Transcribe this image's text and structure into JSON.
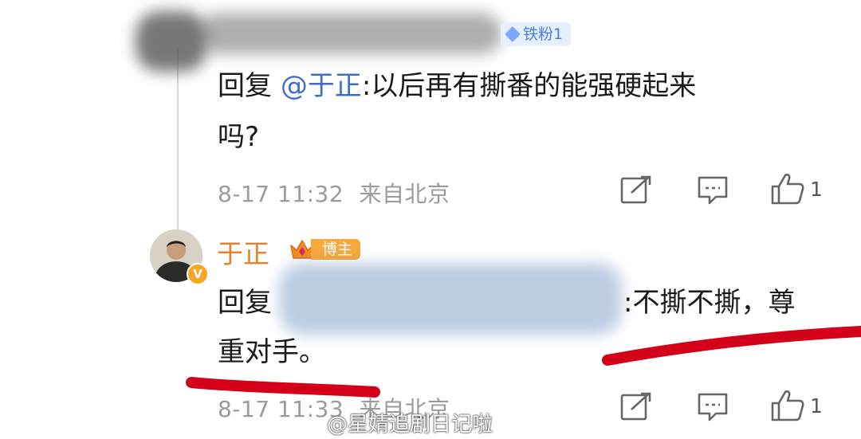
{
  "reply1": {
    "fan_badge": "铁粉1",
    "prefix": "回复",
    "mention": "@于正",
    "text_line1": ":以后再有撕番的能强硬起来",
    "text_line2": "吗?",
    "time": "8-17 11:32",
    "location": "来自北京",
    "like_count": "1"
  },
  "reply2": {
    "author": "于正",
    "badge": "博主",
    "prefix": "回复",
    "text_line1_tail": ":不撕不撕，尊",
    "text_line2": "重对手。",
    "time": "8-17 11:33",
    "location": "来自北京",
    "like_count": "1"
  },
  "watermark": "@星婧追剧日记啦",
  "colors": {
    "mention": "#3f6fc5",
    "author": "#e2832b",
    "meta": "#9b9b9b",
    "underline": "#d4001a",
    "fan_badge_bg": "#e6efff"
  },
  "icons": [
    "repost-icon",
    "comment-icon",
    "like-icon",
    "verified-icon",
    "crown-icon"
  ]
}
